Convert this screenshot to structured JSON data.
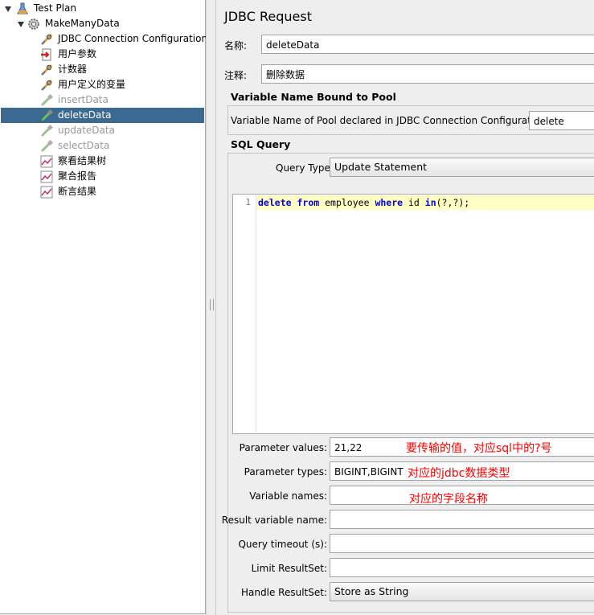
{
  "tree": {
    "items": [
      {
        "label": "Test Plan"
      },
      {
        "label": "MakeManyData"
      },
      {
        "label": "JDBC Connection Configuration"
      },
      {
        "label": "用户参数"
      },
      {
        "label": "计数器"
      },
      {
        "label": "用户定义的变量"
      },
      {
        "label": "insertData"
      },
      {
        "label": "deleteData"
      },
      {
        "label": "updateData"
      },
      {
        "label": "selectData"
      },
      {
        "label": "察看结果树"
      },
      {
        "label": "聚合报告"
      },
      {
        "label": "断言结果"
      }
    ]
  },
  "panel": {
    "title": "JDBC Request",
    "name_label": "名称:",
    "name_value": "deleteData",
    "comment_label": "注释:",
    "comment_value": "删除数据"
  },
  "pool": {
    "section_title": "Variable Name Bound to Pool",
    "label": "Variable Name of Pool declared in JDBC Connection Configuration:",
    "value": "delete"
  },
  "sql": {
    "section_title": "SQL Query",
    "query_type_label": "Query Type:",
    "query_type_value": "Update Statement",
    "line_number": "1",
    "code": {
      "t1": "delete",
      "t2": " ",
      "t3": "from",
      "t4": " employee ",
      "t5": "where",
      "t6": " id ",
      "t7": "in",
      "t8": "(?,?);"
    }
  },
  "params": {
    "values_label": "Parameter values:",
    "values_value": "21,22",
    "types_label": "Parameter types:",
    "types_value": "BIGINT,BIGINT",
    "varnames_label": "Variable names:",
    "varnames_value": "",
    "resultvar_label": "Result variable name:",
    "resultvar_value": "",
    "timeout_label": "Query timeout (s):",
    "timeout_value": "",
    "limit_label": "Limit ResultSet:",
    "limit_value": "",
    "handle_label": "Handle ResultSet:",
    "handle_value": "Store as String"
  },
  "annotations": {
    "values_note": "要传输的值，对应sql中的?号",
    "types_note": "对应的jdbc数据类型",
    "varnames_note": "对应的字段名称"
  },
  "colors": {
    "selection": "#3c698f",
    "annotation": "#ff0000",
    "code_highlight": "#ffffc4",
    "keyword": "#0000e6"
  }
}
